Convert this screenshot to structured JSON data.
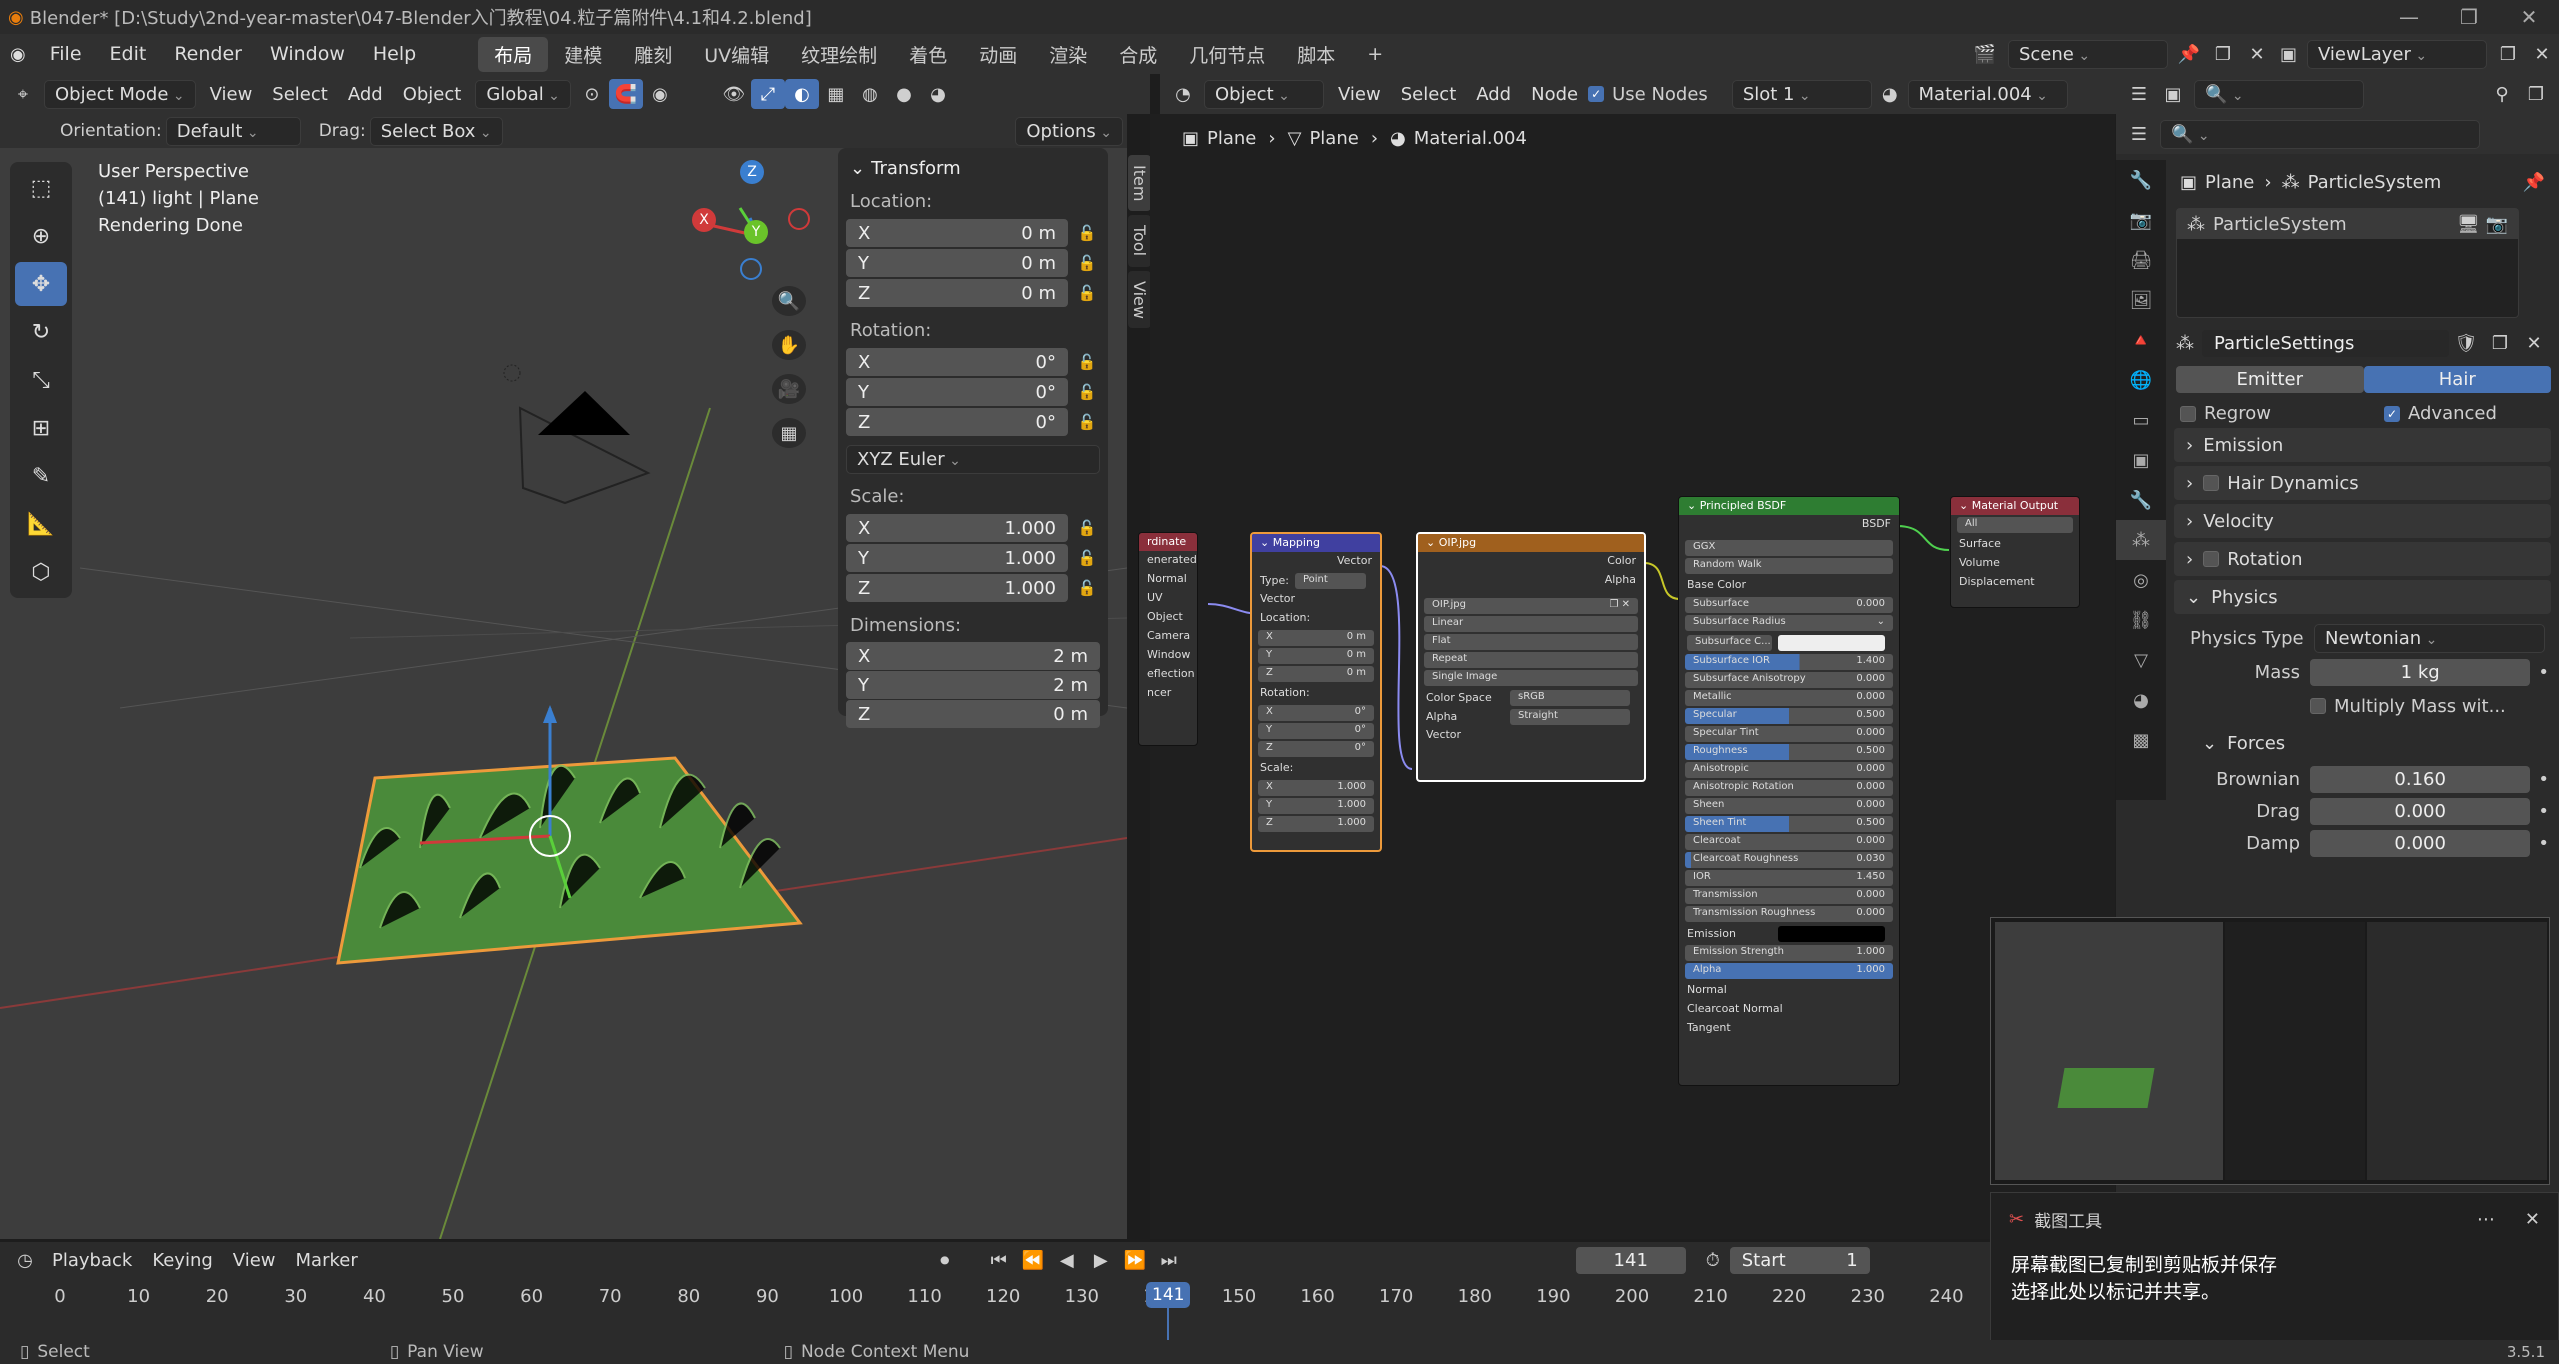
{
  "titlebar": {
    "text": "Blender* [D:\\Study\\2nd-year-master\\047-Blender入门教程\\04.粒子篇附件\\4.1和4.2.blend]"
  },
  "menu": {
    "items": [
      "File",
      "Edit",
      "Render",
      "Window",
      "Help"
    ]
  },
  "workspaces": [
    "布局",
    "建模",
    "雕刻",
    "UV编辑",
    "纹理绘制",
    "着色",
    "动画",
    "渲染",
    "合成",
    "几何节点",
    "脚本"
  ],
  "scene": {
    "label": "Scene",
    "viewlayer": "ViewLayer"
  },
  "viewport": {
    "mode": "Object Mode",
    "menus": [
      "View",
      "Select",
      "Add",
      "Object"
    ],
    "transform": "Global",
    "orientation_label": "Orientation:",
    "orientation": "Default",
    "drag_label": "Drag:",
    "drag": "Select Box",
    "options": "Options",
    "overlay": [
      "User Perspective",
      "(141) light | Plane",
      "Rendering Done"
    ],
    "gizmo": {
      "x": "X",
      "y": "Y",
      "z": "Z"
    }
  },
  "npanel": {
    "title": "Transform",
    "location": "Location:",
    "rotation": "Rotation:",
    "scale": "Scale:",
    "dimensions": "Dimensions:",
    "loc": [
      {
        "a": "X",
        "v": "0 m"
      },
      {
        "a": "Y",
        "v": "0 m"
      },
      {
        "a": "Z",
        "v": "0 m"
      }
    ],
    "rot": [
      {
        "a": "X",
        "v": "0°"
      },
      {
        "a": "Y",
        "v": "0°"
      },
      {
        "a": "Z",
        "v": "0°"
      }
    ],
    "rotmode": "XYZ Euler",
    "scl": [
      {
        "a": "X",
        "v": "1.000"
      },
      {
        "a": "Y",
        "v": "1.000"
      },
      {
        "a": "Z",
        "v": "1.000"
      }
    ],
    "dim": [
      {
        "a": "X",
        "v": "2 m"
      },
      {
        "a": "Y",
        "v": "2 m"
      },
      {
        "a": "Z",
        "v": "0 m"
      }
    ],
    "tabs": [
      "Item",
      "Tool",
      "View"
    ]
  },
  "nodeeditor": {
    "type": "Object",
    "menus": [
      "View",
      "Select",
      "Add",
      "Node"
    ],
    "use_nodes": "Use Nodes",
    "slot": "Slot 1",
    "material": "Material.004",
    "breadcrumb": [
      "Plane",
      "Plane",
      "Material.004"
    ]
  },
  "nodes": {
    "texcoord": {
      "title": "rdinate",
      "outs": [
        "enerated",
        "Normal",
        "UV",
        "Object",
        "Camera",
        "Window",
        "eflection"
      ],
      "footer": "ncer"
    },
    "mapping": {
      "title": "Mapping",
      "out": "Vector",
      "type_label": "Type:",
      "type": "Point",
      "vector": "Vector",
      "location": "Location:",
      "rotation": "Rotation:",
      "scale": "Scale:",
      "loc": [
        [
          "X",
          "0 m"
        ],
        [
          "Y",
          "0 m"
        ],
        [
          "Z",
          "0 m"
        ]
      ],
      "rot": [
        [
          "X",
          "0°"
        ],
        [
          "Y",
          "0°"
        ],
        [
          "Z",
          "0°"
        ]
      ],
      "scl": [
        [
          "X",
          "1.000"
        ],
        [
          "Y",
          "1.000"
        ],
        [
          "Z",
          "1.000"
        ]
      ]
    },
    "image": {
      "title": "OIP.jpg",
      "outs": [
        "Color",
        "Alpha"
      ],
      "img": "OIP.jpg",
      "interp": "Linear",
      "proj": "Flat",
      "ext": "Repeat",
      "src": "Single Image",
      "cs_label": "Color Space",
      "cs": "sRGB",
      "alpha_label": "Alpha",
      "alpha": "Straight",
      "vector": "Vector"
    },
    "bsdf": {
      "title": "Principled BSDF",
      "out": "BSDF",
      "dist": "GGX",
      "sss": "Random Walk",
      "base": "Base Color",
      "fields": [
        [
          "Subsurface",
          "0.000",
          0
        ],
        [
          "Subsurface Radius",
          "",
          -1
        ],
        [
          "Subsurface C...",
          "",
          -2
        ],
        [
          "Subsurface IOR",
          "1.400",
          0.55
        ],
        [
          "Subsurface Anisotropy",
          "0.000",
          0
        ],
        [
          "Metallic",
          "0.000",
          0
        ],
        [
          "Specular",
          "0.500",
          0.5
        ],
        [
          "Specular Tint",
          "0.000",
          0
        ],
        [
          "Roughness",
          "0.500",
          0.5
        ],
        [
          "Anisotropic",
          "0.000",
          0
        ],
        [
          "Anisotropic Rotation",
          "0.000",
          0
        ],
        [
          "Sheen",
          "0.000",
          0
        ],
        [
          "Sheen Tint",
          "0.500",
          0.5
        ],
        [
          "Clearcoat",
          "0.000",
          0
        ],
        [
          "Clearcoat Roughness",
          "0.030",
          0.03
        ],
        [
          "IOR",
          "1.450",
          0
        ],
        [
          "Transmission",
          "0.000",
          0
        ],
        [
          "Transmission Roughness",
          "0.000",
          0
        ],
        [
          "Emission",
          "",
          -3
        ],
        [
          "Emission Strength",
          "1.000",
          0
        ],
        [
          "Alpha",
          "1.000",
          1
        ]
      ],
      "tail": [
        "Normal",
        "Clearcoat Normal",
        "Tangent"
      ]
    },
    "output": {
      "title": "Material Output",
      "target": "All",
      "ins": [
        "Surface",
        "Volume",
        "Displacement"
      ]
    }
  },
  "properties": {
    "breadcrumb": [
      "Plane",
      "ParticleSystem"
    ],
    "system": "ParticleSystem",
    "settings": "ParticleSettings",
    "emitter": "Emitter",
    "hair": "Hair",
    "regrow": "Regrow",
    "advanced": "Advanced",
    "sections": [
      "Emission",
      "Hair Dynamics",
      "Velocity",
      "Rotation",
      "Physics"
    ],
    "physics_type_label": "Physics Type",
    "physics_type": "Newtonian",
    "mass_label": "Mass",
    "mass": "1 kg",
    "multiply": "Multiply Mass wit...",
    "forces": "Forces",
    "brownian_label": "Brownian",
    "brownian": "0.160",
    "drag_label": "Drag",
    "drag": "0.000",
    "damp_label": "Damp",
    "damp": "0.000"
  },
  "timeline": {
    "menus": [
      "Playback",
      "Keying",
      "View",
      "Marker"
    ],
    "current": "141",
    "start_label": "Start",
    "start": "1",
    "ticks": [
      "0",
      "10",
      "20",
      "30",
      "40",
      "50",
      "60",
      "70",
      "80",
      "90",
      "100",
      "110",
      "120",
      "130",
      "140",
      "150",
      "160",
      "170",
      "180",
      "190",
      "200",
      "210",
      "220",
      "230",
      "240"
    ]
  },
  "status": {
    "select": "Select",
    "pan": "Pan View",
    "context": "Node Context Menu",
    "version": "3.5.1"
  },
  "notification": {
    "app": "截图工具",
    "line1": "屏幕截图已复制到剪贴板并保存",
    "line2": "选择此处以标记并共享。"
  }
}
